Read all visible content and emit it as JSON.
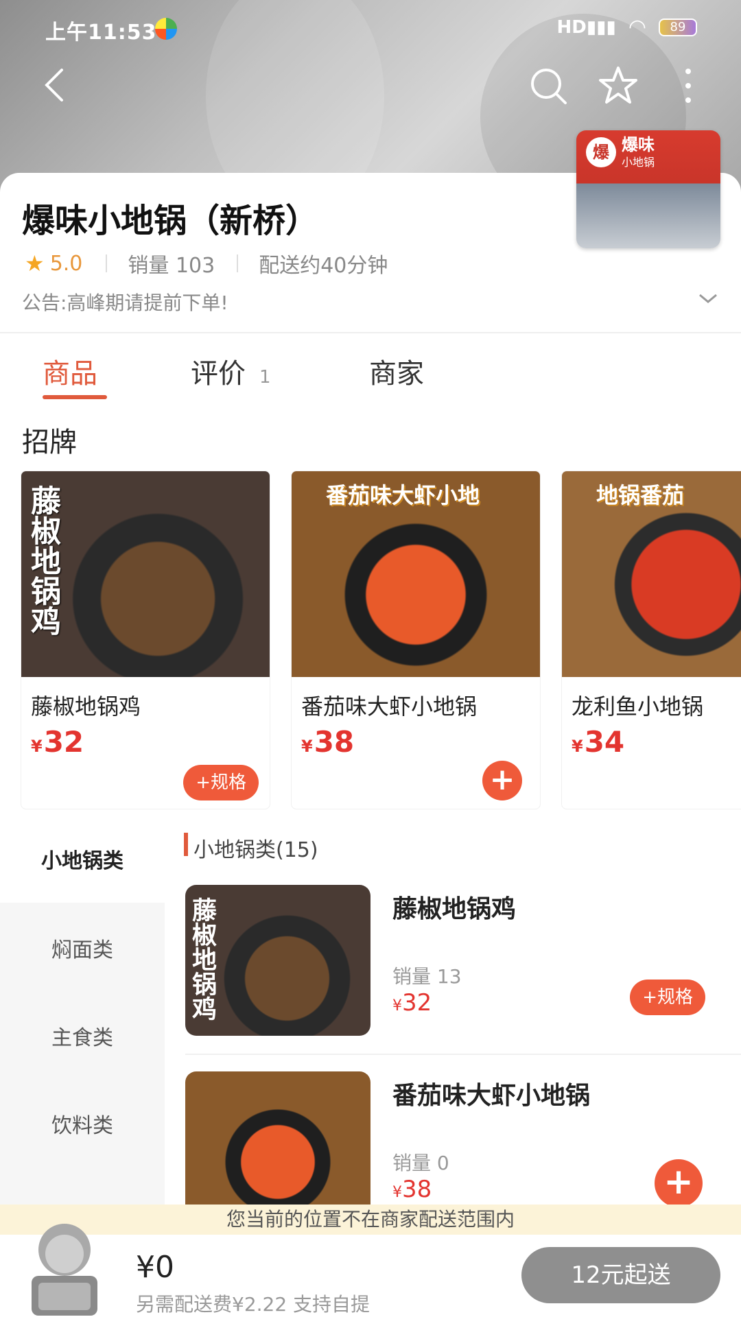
{
  "status_bar": {
    "time": "上午11:53",
    "signal": "HD",
    "battery": "89"
  },
  "store": {
    "name": "爆味小地锅（新桥）",
    "thumb_logo": "爆",
    "thumb_brand": "爆味",
    "thumb_brand_sub": "小地锅",
    "rating": "5.0",
    "sales": "销量 103",
    "delivery_time": "配送约40分钟",
    "notice": "公告:高峰期请提前下单!"
  },
  "tabs": [
    {
      "label": "商品"
    },
    {
      "label": "评价",
      "count": "1"
    },
    {
      "label": "商家"
    }
  ],
  "signature": {
    "title": "招牌",
    "items": [
      {
        "name": "藤椒地锅鸡",
        "currency": "¥",
        "price": "32",
        "button": "+规格",
        "overlay": "藤椒地锅鸡"
      },
      {
        "name": "番茄味大虾小地锅",
        "currency": "¥",
        "price": "38",
        "button": "+",
        "overlay": "番茄味大虾小地"
      },
      {
        "name": "龙利鱼小地锅",
        "currency": "¥",
        "price": "34",
        "button": "+",
        "overlay": "地锅番茄"
      }
    ]
  },
  "categories": [
    {
      "label": "小地锅类"
    },
    {
      "label": "焖面类"
    },
    {
      "label": "主食类"
    },
    {
      "label": "饮料类"
    }
  ],
  "list": {
    "header": "小地锅类(15)",
    "items": [
      {
        "name": "藤椒地锅鸡",
        "sales": "销量 13",
        "currency": "¥",
        "price": "32",
        "button": "+规格"
      },
      {
        "name": "番茄味大虾小地锅",
        "sales": "销量 0",
        "currency": "¥",
        "price": "38",
        "button": "+"
      }
    ]
  },
  "bottom": {
    "range_notice": "您当前的位置不在商家配送范围内",
    "total": "¥0",
    "fee_note": "另需配送费¥2.22 支持自提",
    "start_button": "12元起送"
  },
  "colors": {
    "accent": "#e05a3c",
    "price": "#e3342f",
    "star": "#f5a623"
  }
}
